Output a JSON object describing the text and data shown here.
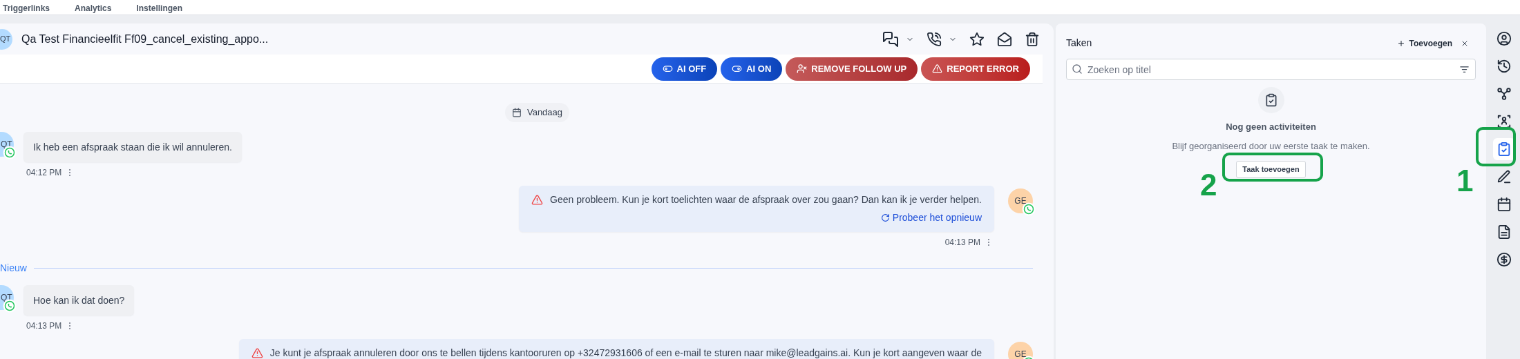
{
  "top_nav": {
    "items": [
      "Triggerlinks",
      "Analytics",
      "Instellingen"
    ]
  },
  "conversation": {
    "avatar": "QT",
    "title": "Qa Test Financieelfit Ff09_cancel_existing_appo...",
    "actions": [
      {
        "kind": "toggle_off",
        "label": "AI OFF"
      },
      {
        "kind": "toggle_on",
        "label": "AI ON"
      },
      {
        "kind": "remove_follow_up",
        "label": "REMOVE FOLLOW UP"
      },
      {
        "kind": "report_error",
        "label": "REPORT ERROR"
      }
    ],
    "date_chip": "Vandaag",
    "timeline": [
      {
        "kind": "message",
        "outgoing": false,
        "avatar": "QT",
        "text": "Ik heb een afspraak staan die ik wil annuleren.",
        "time": "04:12 PM",
        "failed": false
      },
      {
        "kind": "message",
        "outgoing": true,
        "avatar": "GE",
        "text": "Geen probleem. Kun je kort toelichten waar de afspraak over zou gaan? Dan kan ik je verder helpen.",
        "retry": "Probeer het opnieuw",
        "time": "04:13 PM",
        "failed": true
      },
      {
        "kind": "divider",
        "label": "Nieuw"
      },
      {
        "kind": "message",
        "outgoing": false,
        "avatar": "QT",
        "text": "Hoe kan ik dat doen?",
        "time": "04:13 PM",
        "failed": false
      },
      {
        "kind": "message",
        "outgoing": true,
        "avatar": "GE",
        "text": "Je kunt je afspraak annuleren door ons te bellen tijdens kantooruren op +32472931606 of een e-mail te sturen naar mike@leadgains.ai. Kun je kort aangeven waar de",
        "failed": true
      }
    ]
  },
  "tasks_panel": {
    "title": "Taken",
    "add_label": "Toevoegen",
    "search": {
      "placeholder": "Zoeken op titel"
    },
    "empty_title": "Nog geen activiteiten",
    "empty_text": "Blijf georganiseerd door uw eerste taak te maken.",
    "empty_button": "Taak toevoegen"
  },
  "rail": [
    {
      "kind": "contact",
      "selected": false
    },
    {
      "kind": "history",
      "selected": false
    },
    {
      "kind": "workflow",
      "selected": false
    },
    {
      "kind": "group",
      "selected": false
    },
    {
      "kind": "tasks",
      "selected": true
    },
    {
      "kind": "notes",
      "selected": false
    },
    {
      "kind": "calendar",
      "selected": false
    },
    {
      "kind": "document",
      "selected": false
    },
    {
      "kind": "payments",
      "selected": false
    }
  ],
  "annotations": [
    {
      "label": "2"
    },
    {
      "label": "1"
    }
  ]
}
